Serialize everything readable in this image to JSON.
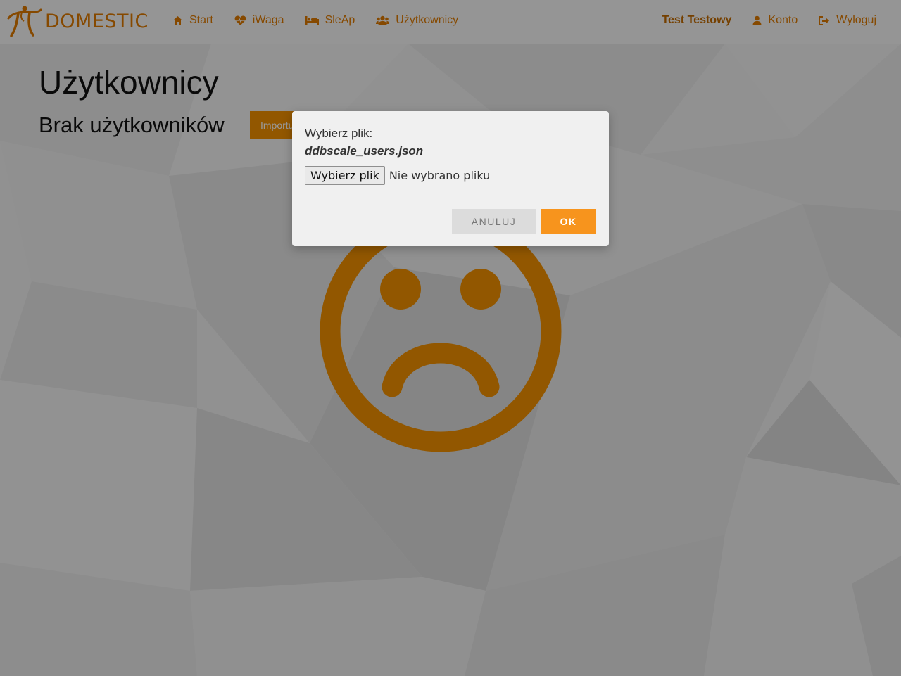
{
  "navbar": {
    "brand": "DOMESTIC",
    "left_items": [
      {
        "label": "Start",
        "icon": "home-icon"
      },
      {
        "label": "iWaga",
        "icon": "heartbeat-icon"
      },
      {
        "label": "SleAp",
        "icon": "bed-icon"
      },
      {
        "label": "Użytkownicy",
        "icon": "users-icon"
      }
    ],
    "right_items": [
      {
        "label": "Test Testowy"
      },
      {
        "label": "Konto",
        "icon": "user-icon"
      },
      {
        "label": "Wyloguj",
        "icon": "sign-out-icon"
      }
    ]
  },
  "page": {
    "title": "Użytkownicy",
    "subtitle": "Brak użytkowników",
    "import_label": "Importuj"
  },
  "modal": {
    "label": "Wybierz plik:",
    "filename": "ddbscale_users.json",
    "file_button": "Wybierz plik",
    "file_status": "Nie wybrano pliku",
    "cancel_label": "ANULUJ",
    "ok_label": "OK"
  },
  "colors": {
    "accent": "#f39200",
    "brand": "#e07b00",
    "sad_face": "#f39200"
  }
}
